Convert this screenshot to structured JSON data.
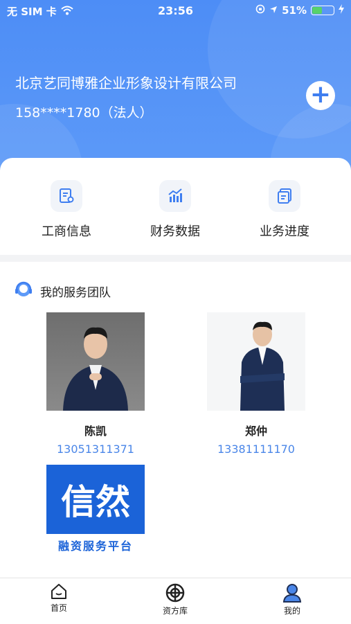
{
  "status_bar": {
    "carrier": "无 SIM 卡",
    "time": "23:56",
    "battery_percent": "51%",
    "battery_level": 0.51
  },
  "header": {
    "company_name": "北京艺同博雅企业形象设计有限公司",
    "phone": "158****1780（法人）",
    "add_icon": "plus-icon"
  },
  "quick_actions": [
    {
      "label": "工商信息",
      "icon": "business-license-icon"
    },
    {
      "label": "财务数据",
      "icon": "finance-chart-icon"
    },
    {
      "label": "业务进度",
      "icon": "progress-docs-icon"
    }
  ],
  "team": {
    "title": "我的服务团队",
    "members": [
      {
        "name": "陈凯",
        "phone": "13051311371"
      },
      {
        "name": "郑仲",
        "phone": "13381111170"
      },
      {
        "logo_text": "信然",
        "logo_subtitle": "融资服务平台"
      }
    ]
  },
  "tabbar": {
    "items": [
      {
        "label": "首页",
        "icon": "home-icon"
      },
      {
        "label": "资方库",
        "icon": "target-icon"
      },
      {
        "label": "我的",
        "icon": "profile-icon",
        "active": true
      }
    ]
  },
  "colors": {
    "header_blue": "#4d8df6",
    "accent_blue": "#4a86e8",
    "brand_blue": "#1b63d8"
  }
}
